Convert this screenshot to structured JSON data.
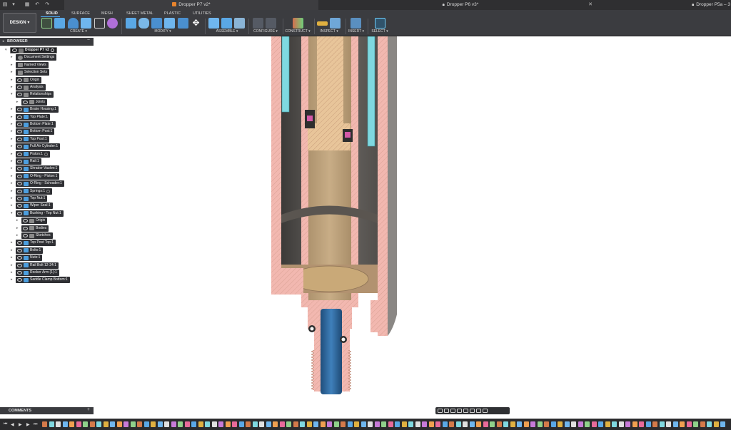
{
  "doc_tabs": [
    {
      "label": "Dropper P7 v2*",
      "icon": "design-doc-icon",
      "color": "#e8842d",
      "closable": false
    },
    {
      "label": "Dropper P6 v3*",
      "icon": "lock-icon",
      "color": "#bdbdbd",
      "closable": true
    },
    {
      "label": "Dropper P5a – 3",
      "icon": "lock-icon",
      "color": "#bdbdbd",
      "closable": false
    }
  ],
  "quick_access": [
    "file-icon",
    "grid-icon",
    "undo-icon",
    "redo-icon"
  ],
  "workspace": {
    "label": "DESIGN",
    "dropdown": "▾"
  },
  "ribbon_tabs": [
    "SOLID",
    "SURFACE",
    "MESH",
    "SHEET METAL",
    "PLASTIC",
    "UTILITIES"
  ],
  "ribbon_groups": [
    {
      "label": "CREATE ▾"
    },
    {
      "label": "MODIFY ▾"
    },
    {
      "label": "ASSEMBLE ▾"
    },
    {
      "label": "CONFIGURE ▾"
    },
    {
      "label": "CONSTRUCT ▾"
    },
    {
      "label": "INSPECT ▾"
    },
    {
      "label": "INSERT ▾"
    },
    {
      "label": "SELECT ▾"
    }
  ],
  "browser": {
    "title": "BROWSER",
    "root": "Dropper P7 v2",
    "items": [
      {
        "label": "Document Settings",
        "indent": 1,
        "eye": false,
        "icon": "gear",
        "color": "#8a8a8a",
        "expanded": false
      },
      {
        "label": "Named Views",
        "indent": 1,
        "eye": false,
        "icon": "folder",
        "color": "#8a8a8a",
        "expanded": false
      },
      {
        "label": "Selection Sets",
        "indent": 1,
        "eye": false,
        "icon": "folder",
        "color": "#8a8a8a",
        "expanded": false
      },
      {
        "label": "Origin",
        "indent": 1,
        "eye": true,
        "icon": "folder",
        "color": "#8a8a8a",
        "expanded": false
      },
      {
        "label": "Analysis",
        "indent": 1,
        "eye": true,
        "icon": "folder",
        "color": "#8a8a8a",
        "expanded": false
      },
      {
        "label": "Relationships",
        "indent": 1,
        "eye": true,
        "icon": "folder",
        "color": "#8a8a8a",
        "expanded": true
      },
      {
        "label": "Joints",
        "indent": 2,
        "eye": true,
        "icon": "folder",
        "color": "#8a8a8a",
        "expanded": false
      },
      {
        "label": "Brake Housing:1",
        "indent": 1,
        "eye": true,
        "icon": "component",
        "color": "#4c9ede",
        "expanded": false
      },
      {
        "label": "Top Plate:1",
        "indent": 1,
        "eye": true,
        "icon": "component",
        "color": "#4c9ede",
        "expanded": false
      },
      {
        "label": "Bottom Plate:1",
        "indent": 1,
        "eye": true,
        "icon": "component",
        "color": "#4c9ede",
        "expanded": false
      },
      {
        "label": "Bottom Post:1",
        "indent": 1,
        "eye": true,
        "icon": "component",
        "color": "#4c9ede",
        "expanded": false
      },
      {
        "label": "Top Post:1",
        "indent": 1,
        "eye": true,
        "icon": "component",
        "color": "#4c9ede",
        "expanded": false
      },
      {
        "label": "Full Air Cylinder:1",
        "indent": 1,
        "eye": true,
        "icon": "component",
        "color": "#4c9ede",
        "expanded": false
      },
      {
        "label": "Piston:1",
        "indent": 1,
        "eye": true,
        "icon": "component",
        "color": "#4c9ede",
        "expanded": false,
        "extra": true
      },
      {
        "label": "Rail:1",
        "indent": 1,
        "eye": true,
        "icon": "component",
        "color": "#4c9ede",
        "expanded": false
      },
      {
        "label": "Shrader Vaulve:1",
        "indent": 1,
        "eye": true,
        "icon": "component",
        "color": "#4c9ede",
        "expanded": false
      },
      {
        "label": "O-Ring - Piston:1",
        "indent": 1,
        "eye": true,
        "icon": "component",
        "color": "#4c9ede",
        "expanded": false
      },
      {
        "label": "O-Ring - Schrader:1",
        "indent": 1,
        "eye": true,
        "icon": "component",
        "color": "#4c9ede",
        "expanded": false
      },
      {
        "label": "Springs:1",
        "indent": 1,
        "eye": true,
        "icon": "component",
        "color": "#4c9ede",
        "expanded": false,
        "extra": true
      },
      {
        "label": "Top Nut:1",
        "indent": 1,
        "eye": true,
        "icon": "component",
        "color": "#4c9ede",
        "expanded": false
      },
      {
        "label": "Wiper Seal:1",
        "indent": 1,
        "eye": true,
        "icon": "component",
        "color": "#4c9ede",
        "expanded": false
      },
      {
        "label": "Bushing - Top Nut:1",
        "indent": 1,
        "eye": true,
        "icon": "component",
        "color": "#4c9ede",
        "expanded": true
      },
      {
        "label": "Origin",
        "indent": 2,
        "eye": true,
        "icon": "folder",
        "color": "#8a8a8a",
        "expanded": false
      },
      {
        "label": "Bodies",
        "indent": 2,
        "eye": true,
        "icon": "folder",
        "color": "#8a8a8a",
        "expanded": false
      },
      {
        "label": "Sketches",
        "indent": 2,
        "eye": true,
        "icon": "folder",
        "color": "#8a8a8a",
        "expanded": false
      },
      {
        "label": "Top Post Top:1",
        "indent": 1,
        "eye": true,
        "icon": "component",
        "color": "#4c9ede",
        "expanded": false
      },
      {
        "label": "Bolts:1",
        "indent": 1,
        "eye": true,
        "icon": "component",
        "color": "#4c9ede",
        "expanded": false
      },
      {
        "label": "Nuts:1",
        "indent": 1,
        "eye": true,
        "icon": "component",
        "color": "#4c9ede",
        "expanded": false
      },
      {
        "label": "Rail Bolt 12-24:1",
        "indent": 1,
        "eye": true,
        "icon": "component",
        "color": "#4c9ede",
        "expanded": false
      },
      {
        "label": "Rocker Arm (1):1",
        "indent": 1,
        "eye": true,
        "icon": "component",
        "color": "#4c9ede",
        "expanded": false
      },
      {
        "label": "Saddle Clamp Bottom:1",
        "indent": 1,
        "eye": true,
        "icon": "component",
        "color": "#4c9ede",
        "expanded": false
      }
    ]
  },
  "comments": {
    "title": "COMMENTS",
    "add": "+"
  },
  "nav_toolbar": [
    "orbit-icon",
    "look-at-icon",
    "pan-icon",
    "zoom-icon",
    "fit-icon",
    "display-settings-icon",
    "grid-settings-icon",
    "viewports-icon"
  ],
  "timeline_controls": [
    "rewind-icon",
    "step-back-icon",
    "play-icon",
    "step-forward-icon",
    "end-icon"
  ],
  "colors": {
    "ui_dark": "#2f2f31",
    "ribbon": "#3b3c40",
    "accent": "#4fb1ff",
    "section_pink": "#f2b8b0",
    "section_bronze": "#c9a978",
    "section_cyan": "#7fd8e0",
    "section_blue": "#2e6fa8"
  }
}
